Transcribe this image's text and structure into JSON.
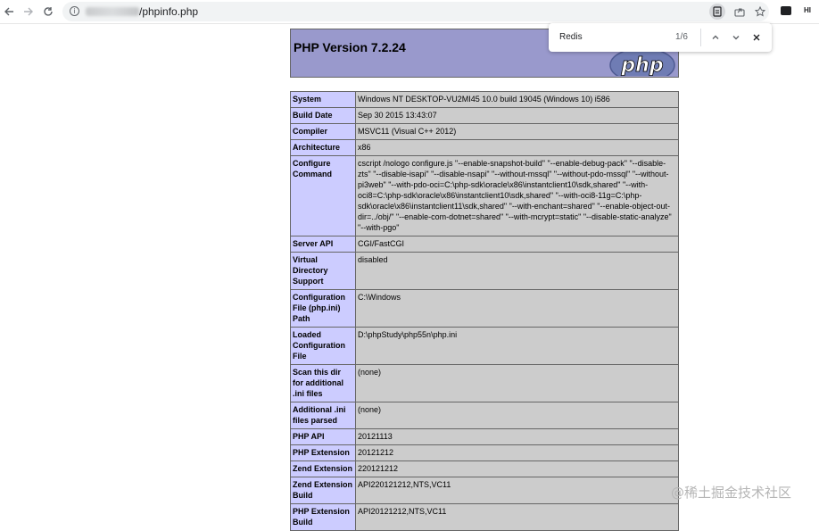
{
  "browser": {
    "url_path": "/phpinfo.php",
    "icons": [
      "back-arrow-icon",
      "forward-arrow-icon",
      "reload-icon",
      "site-info-icon",
      "page-icon",
      "share-icon",
      "bookmark-star-icon",
      "extension-icon",
      "profile-icon"
    ],
    "ext_label": "HI"
  },
  "findbar": {
    "query": "Redis",
    "count": "1/6"
  },
  "page": {
    "title": "PHP Version 7.2.24",
    "logo_text": "php",
    "rows": [
      {
        "label": "System",
        "value": "Windows NT DESKTOP-VU2MI45 10.0 build 19045 (Windows 10) i586"
      },
      {
        "label": "Build Date",
        "value": "Sep 30 2015 13:43:07"
      },
      {
        "label": "Compiler",
        "value": "MSVC11 (Visual C++ 2012)"
      },
      {
        "label": "Architecture",
        "value": "x86"
      },
      {
        "label": "Configure Command",
        "value": "cscript /nologo configure.js \"--enable-snapshot-build\" \"--enable-debug-pack\" \"--disable-zts\" \"--disable-isapi\" \"--disable-nsapi\" \"--without-mssql\" \"--without-pdo-mssql\" \"--without-pi3web\" \"--with-pdo-oci=C:\\php-sdk\\oracle\\x86\\instantclient10\\sdk,shared\" \"--with-oci8=C:\\php-sdk\\oracle\\x86\\instantclient10\\sdk,shared\" \"--with-oci8-11g=C:\\php-sdk\\oracle\\x86\\instantclient11\\sdk,shared\" \"--with-enchant=shared\" \"--enable-object-out-dir=../obj/\" \"--enable-com-dotnet=shared\" \"--with-mcrypt=static\" \"--disable-static-analyze\" \"--with-pgo\""
      },
      {
        "label": "Server API",
        "value": "CGI/FastCGI"
      },
      {
        "label": "Virtual Directory Support",
        "value": "disabled"
      },
      {
        "label": "Configuration File (php.ini) Path",
        "value": "C:\\Windows"
      },
      {
        "label": "Loaded Configuration File",
        "value": "D:\\phpStudy\\php55n\\php.ini"
      },
      {
        "label": "Scan this dir for additional .ini files",
        "value": "(none)"
      },
      {
        "label": "Additional .ini files parsed",
        "value": "(none)"
      },
      {
        "label": "PHP API",
        "value": "20121113"
      },
      {
        "label": "PHP Extension",
        "value": "20121212"
      },
      {
        "label": "Zend Extension",
        "value": "220121212"
      },
      {
        "label": "Zend Extension Build",
        "value": "API220121212,NTS,VC11"
      },
      {
        "label": "PHP Extension Build",
        "value": "API20121212,NTS,VC11"
      }
    ]
  },
  "watermark": "@稀土掘金技术社区",
  "colors": {
    "header_bg": "#9999cc",
    "label_bg": "#ccccff",
    "value_bg": "#cccccc"
  }
}
